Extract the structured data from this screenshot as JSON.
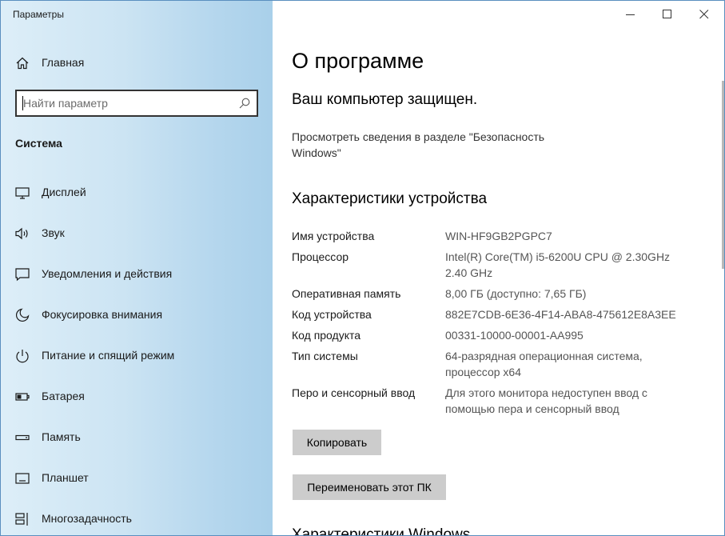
{
  "window": {
    "title": "Параметры"
  },
  "sidebar": {
    "home_label": "Главная",
    "search": {
      "placeholder": "Найти параметр",
      "value": ""
    },
    "section_title": "Система",
    "items": [
      {
        "label": "Дисплей",
        "icon": "display-icon"
      },
      {
        "label": "Звук",
        "icon": "speaker-icon"
      },
      {
        "label": "Уведомления и действия",
        "icon": "notification-icon"
      },
      {
        "label": "Фокусировка внимания",
        "icon": "moon-icon"
      },
      {
        "label": "Питание и спящий режим",
        "icon": "power-icon"
      },
      {
        "label": "Батарея",
        "icon": "battery-icon"
      },
      {
        "label": "Память",
        "icon": "storage-icon"
      },
      {
        "label": "Планшет",
        "icon": "tablet-icon"
      },
      {
        "label": "Многозадачность",
        "icon": "multitasking-icon"
      }
    ]
  },
  "main": {
    "page_title": "О программе",
    "protection": {
      "title": "Ваш компьютер защищен.",
      "link": "Просмотреть сведения в разделе \"Безопасность Windows\""
    },
    "device_specs": {
      "title": "Характеристики устройства",
      "rows": [
        {
          "key": "Имя устройства",
          "value": "WIN-HF9GB2PGPC7"
        },
        {
          "key": "Процессор",
          "value": "Intel(R) Core(TM) i5-6200U CPU @ 2.30GHz   2.40 GHz"
        },
        {
          "key": "Оперативная память",
          "value": "8,00 ГБ (доступно: 7,65 ГБ)"
        },
        {
          "key": "Код устройства",
          "value": "882E7CDB-6E36-4F14-ABA8-475612E8A3EE"
        },
        {
          "key": "Код продукта",
          "value": "00331-10000-00001-AA995"
        },
        {
          "key": "Тип системы",
          "value": "64-разрядная операционная система, процессор x64"
        },
        {
          "key": "Перо и сенсорный ввод",
          "value": "Для этого монитора недоступен ввод с помощью пера и сенсорный ввод"
        }
      ]
    },
    "buttons": {
      "copy": "Копировать",
      "rename": "Переименовать этот ПК"
    },
    "next_section_title": "Характеристики Windows"
  },
  "colors": {
    "sidebar_accent": "#a9d0ea",
    "button_bg": "#cccccc"
  }
}
